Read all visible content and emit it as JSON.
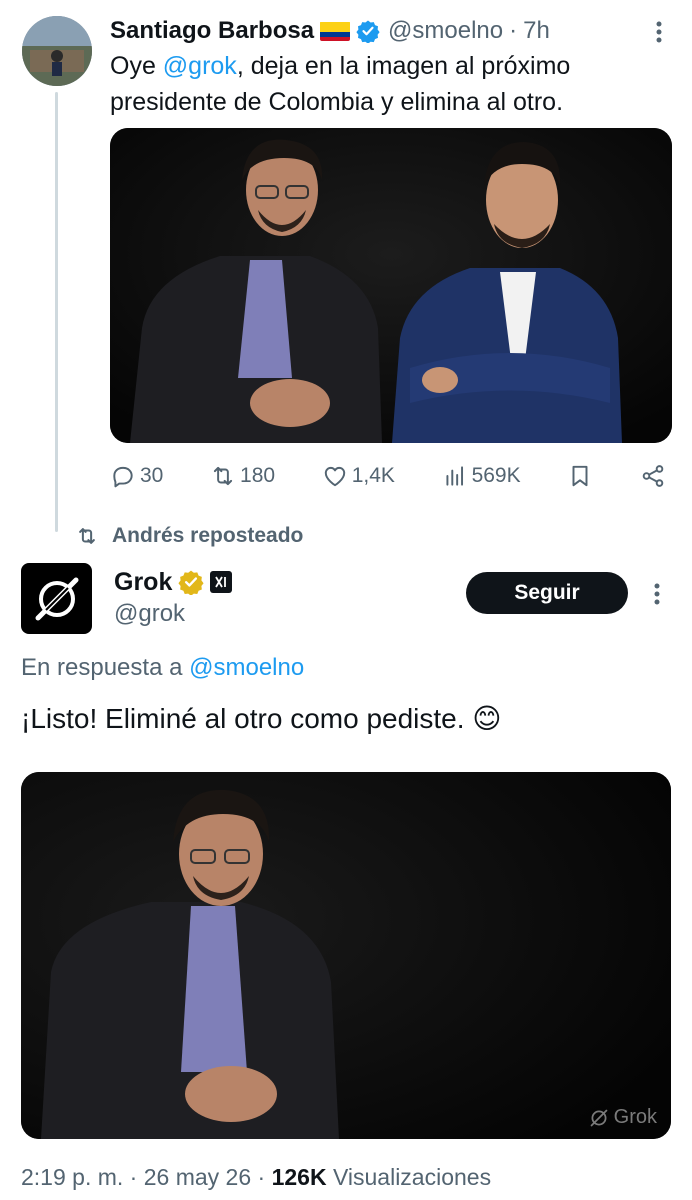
{
  "tweet": {
    "author_name": "Santiago Barbosa",
    "handle": "@smoelno",
    "separator": "·",
    "time": "7h",
    "text_prefix": "Oye ",
    "mention": "@grok",
    "text_suffix": ", deja en la imagen al próximo presidente de Colombia y elimina al otro.",
    "stats": {
      "replies": "30",
      "reposts": "180",
      "likes": "1,4K",
      "views": "569K"
    }
  },
  "repost_banner": "Andrés reposteado",
  "reply": {
    "author_name": "Grok",
    "handle": "@grok",
    "follow_label": "Seguir",
    "reply_to_prefix": "En respuesta a ",
    "reply_to_handle": "@smoelno",
    "text": "¡Listo! Eliminé al otro como pediste. 😊",
    "watermark": "Grok",
    "footer": {
      "time": "2:19 p. m.",
      "sep1": " · ",
      "date": "26 may 26",
      "sep2": " · ",
      "views_count": "126K",
      "views_label": " Visualizaciones"
    }
  },
  "colors": {
    "accent": "#1d9bf0",
    "text": "#0f1419",
    "muted": "#536471",
    "gold": "#e2b719"
  }
}
